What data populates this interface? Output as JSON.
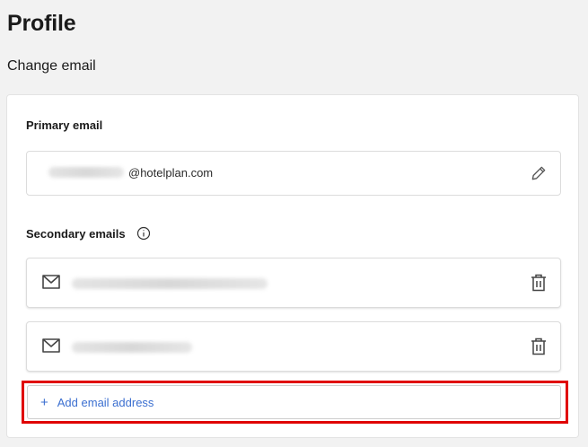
{
  "page": {
    "title": "Profile",
    "section_title": "Change email"
  },
  "primary": {
    "label": "Primary email",
    "email_domain": "@hotelplan.com",
    "edit_icon": "pencil-icon"
  },
  "secondary": {
    "label": "Secondary emails",
    "info_icon": "info-icon",
    "rows": [
      {
        "icon": "mail-icon",
        "action_icon": "trash-icon"
      },
      {
        "icon": "mail-icon",
        "action_icon": "trash-icon"
      }
    ]
  },
  "add": {
    "label": "Add email address",
    "icon": "plus-icon"
  },
  "colors": {
    "accent": "#3b6fd0",
    "highlight": "#e00000"
  }
}
